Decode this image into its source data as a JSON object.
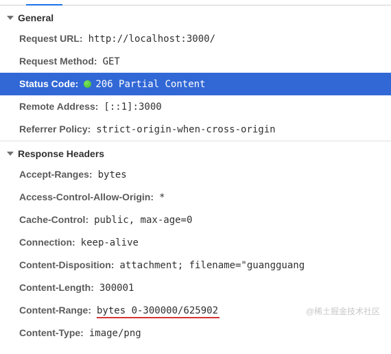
{
  "sections": {
    "general": {
      "title": "General",
      "rows": {
        "request_url": {
          "label": "Request URL:",
          "value": "http://localhost:3000/"
        },
        "request_method": {
          "label": "Request Method:",
          "value": "GET"
        },
        "status_code": {
          "label": "Status Code:",
          "value": "206 Partial Content"
        },
        "remote_address": {
          "label": "Remote Address:",
          "value": "[::1]:3000"
        },
        "referrer_policy": {
          "label": "Referrer Policy:",
          "value": "strict-origin-when-cross-origin"
        }
      }
    },
    "response_headers": {
      "title": "Response Headers",
      "rows": {
        "accept_ranges": {
          "label": "Accept-Ranges:",
          "value": "bytes"
        },
        "acao": {
          "label": "Access-Control-Allow-Origin:",
          "value": "*"
        },
        "cache_control": {
          "label": "Cache-Control:",
          "value": "public, max-age=0"
        },
        "connection": {
          "label": "Connection:",
          "value": "keep-alive"
        },
        "content_disposition": {
          "label": "Content-Disposition:",
          "value": "attachment; filename=\"guangguang"
        },
        "content_length": {
          "label": "Content-Length:",
          "value": "300001"
        },
        "content_range": {
          "label": "Content-Range:",
          "value": "bytes 0-300000/625902"
        },
        "content_type": {
          "label": "Content-Type:",
          "value": "image/png"
        }
      }
    }
  },
  "watermark": "@稀土掘金技术社区"
}
